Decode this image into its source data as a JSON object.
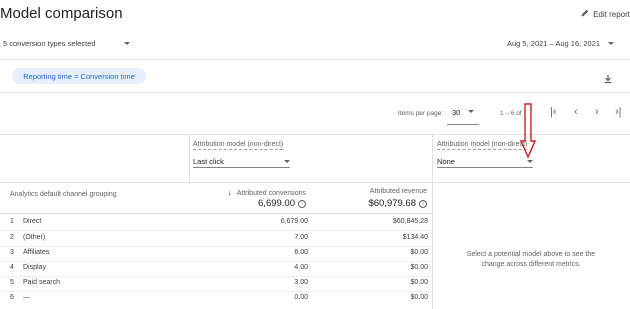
{
  "header": {
    "title": "Model comparison",
    "edit_label": "Edit report"
  },
  "filters": {
    "conversion_types": "5 conversion types selected",
    "date_range": "Aug 5, 2021 – Aug 16, 2021"
  },
  "chip": {
    "label": "Reporting time = Conversion time"
  },
  "pagination": {
    "items_label": "Items per page:",
    "items_value": "30",
    "range_label": "1 – 6 of"
  },
  "columns": {
    "dimension": "Analytics default channel grouping",
    "left_model": {
      "label": "Attribution model (non-direct)",
      "value": "Last click"
    },
    "right_model": {
      "label": "Attribution model (non-direct)",
      "value": "None"
    },
    "conversions": {
      "label": "Attributed conversions",
      "total": "6,699.00"
    },
    "revenue": {
      "label": "Attributed revenue",
      "total": "$60,979.68"
    }
  },
  "rows": [
    {
      "index": "1",
      "channel": "Direct",
      "conversions": "6,679.00",
      "revenue": "$60,845.28"
    },
    {
      "index": "2",
      "channel": "(Other)",
      "conversions": "7.00",
      "revenue": "$134.40"
    },
    {
      "index": "3",
      "channel": "Affiliates",
      "conversions": "6.00",
      "revenue": "$0.00"
    },
    {
      "index": "4",
      "channel": "Display",
      "conversions": "4.00",
      "revenue": "$0.00"
    },
    {
      "index": "5",
      "channel": "Paid search",
      "conversions": "3.00",
      "revenue": "$0.00"
    },
    {
      "index": "6",
      "channel": "—",
      "conversions": "0.00",
      "revenue": "$0.00"
    }
  ],
  "empty_state": {
    "message": "Select a potential model above to see the change across different metrics."
  },
  "colors": {
    "accent": "#1967d2",
    "chip_bg": "#e8f0fe",
    "annotation": "#c5221f"
  }
}
